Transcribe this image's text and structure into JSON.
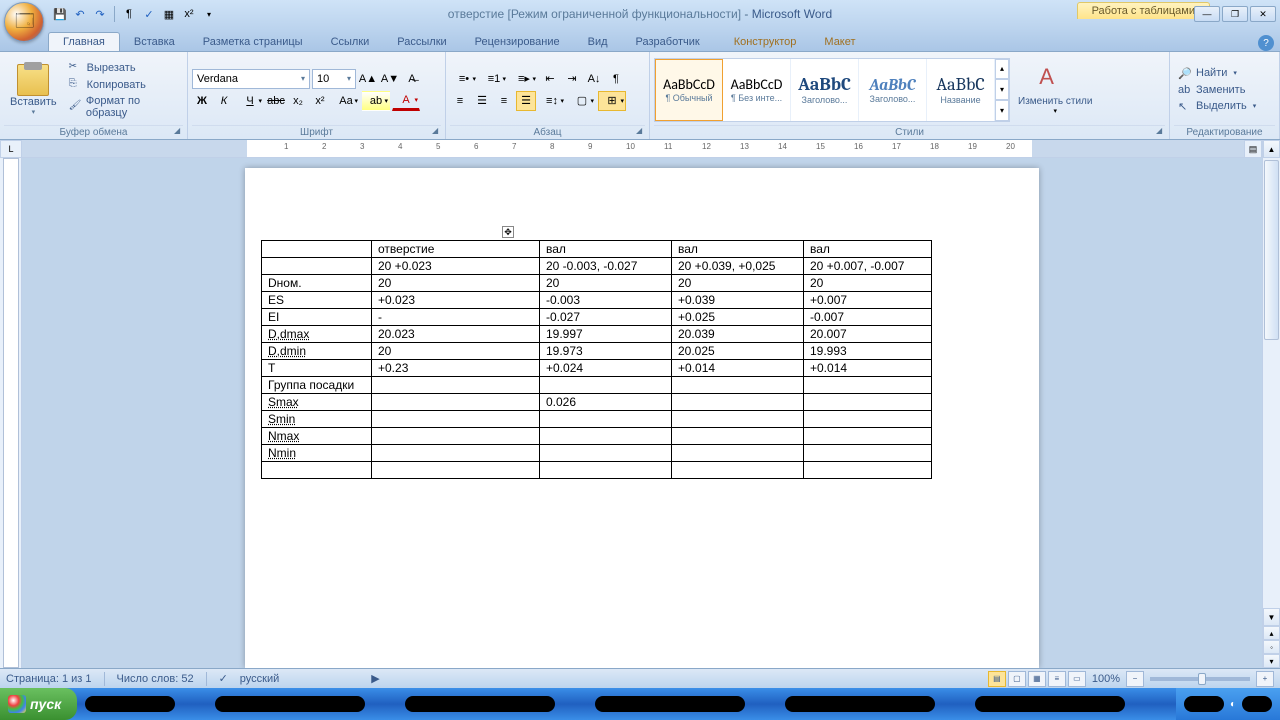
{
  "title": {
    "doc": "отверстие [Режим ограниченной функциональности]",
    "app": "Microsoft Word",
    "tools": "Работа с таблицами"
  },
  "tabs": [
    "Главная",
    "Вставка",
    "Разметка страницы",
    "Ссылки",
    "Рассылки",
    "Рецензирование",
    "Вид",
    "Разработчик",
    "Конструктор",
    "Макет"
  ],
  "clipboard": {
    "paste": "Вставить",
    "cut": "Вырезать",
    "copy": "Копировать",
    "fmt": "Формат по образцу",
    "group": "Буфер обмена"
  },
  "font": {
    "name": "Verdana",
    "size": "10",
    "group": "Шрифт"
  },
  "para": {
    "group": "Абзац"
  },
  "styles": {
    "group": "Стили",
    "change": "Изменить стили",
    "items": [
      {
        "prev": "AaBbCcD",
        "lbl": "¶ Обычный",
        "f": "Calibri"
      },
      {
        "prev": "AaBbCcD",
        "lbl": "¶ Без инте...",
        "f": "Calibri"
      },
      {
        "prev": "AaBbC",
        "lbl": "Заголово...",
        "f": "Cambria",
        "b": true,
        "c": "#1f497d",
        "s": "18px"
      },
      {
        "prev": "AaBbC",
        "lbl": "Заголово...",
        "f": "Cambria",
        "b": true,
        "i": true,
        "c": "#4f81bd",
        "s": "16px"
      },
      {
        "prev": "AaBbC",
        "lbl": "Название",
        "f": "Cambria",
        "c": "#17365d",
        "s": "18px"
      }
    ]
  },
  "editing": {
    "group": "Редактирование",
    "find": "Найти",
    "replace": "Заменить",
    "select": "Выделить"
  },
  "ruler_nums": [
    "1",
    "2",
    "3",
    "4",
    "5",
    "6",
    "7",
    "8",
    "9",
    "10",
    "11",
    "12",
    "13",
    "14",
    "15",
    "16",
    "17",
    "18",
    "19",
    "20"
  ],
  "table": {
    "cols": [
      110,
      168,
      132,
      132,
      128
    ],
    "rows": [
      [
        "",
        "отверстие",
        "вал",
        "вал",
        "вал"
      ],
      [
        "",
        "20 +0.023",
        "20 -0.003, -0.027",
        "20 +0.039, +0,025",
        "20 +0.007, -0.007"
      ],
      [
        "Dном.",
        "20",
        "20",
        "20",
        "20"
      ],
      [
        "ES",
        "+0.023",
        "-0.003",
        "+0.039",
        "+0.007"
      ],
      [
        "EI",
        "-",
        "-0.027",
        "+0.025",
        "-0.007"
      ],
      [
        "D,dmax",
        "20.023",
        "19.997",
        "20.039",
        "20.007"
      ],
      [
        "D,dmin",
        "20",
        "19.973",
        "20.025",
        "19.993"
      ],
      [
        "T",
        "+0.23",
        "+0.024",
        "+0.014",
        "+0.014"
      ],
      [
        "Группа посадки",
        "",
        "",
        "",
        ""
      ],
      [
        "Smax",
        "",
        "0.026",
        "",
        ""
      ],
      [
        "Smin",
        "",
        "",
        "",
        ""
      ],
      [
        "Nmax",
        "",
        "",
        "",
        ""
      ],
      [
        "Nmin",
        "",
        "",
        "",
        ""
      ],
      [
        "",
        "",
        "",
        "",
        ""
      ]
    ],
    "underline_rows": [
      5,
      6,
      9,
      10,
      11,
      12
    ]
  },
  "status": {
    "page": "Страница: 1 из 1",
    "words": "Число слов: 52",
    "lang": "русский",
    "zoom": "100%"
  },
  "taskbar": {
    "start": "пуск"
  }
}
